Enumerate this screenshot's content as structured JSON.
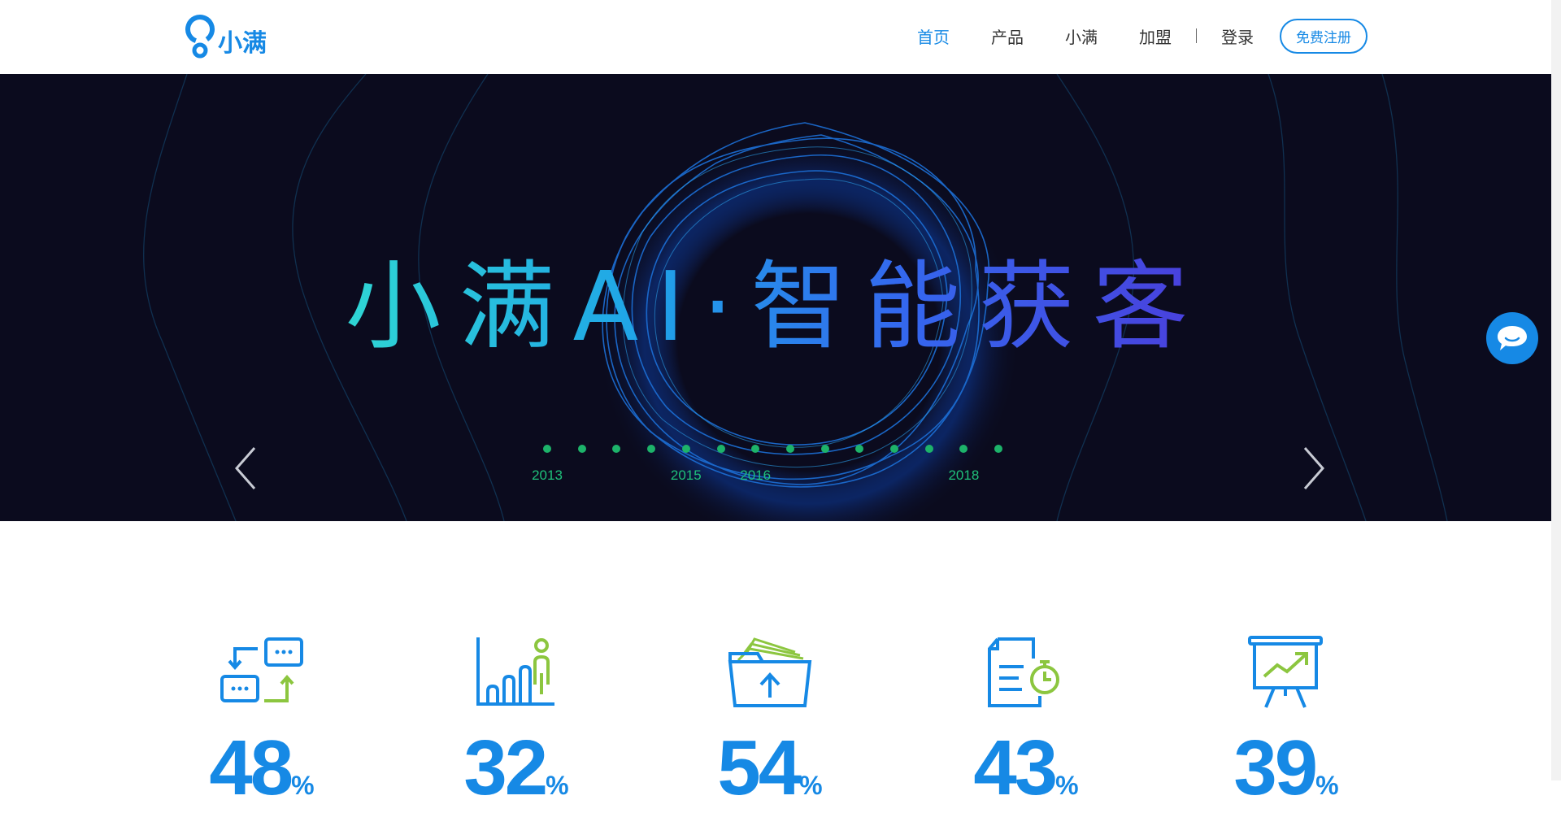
{
  "brand": {
    "name": "小满",
    "color": "#1689e5"
  },
  "nav": {
    "items": [
      {
        "label": "首页",
        "active": true
      },
      {
        "label": "产品",
        "active": false
      },
      {
        "label": "小满",
        "active": false
      },
      {
        "label": "加盟",
        "active": false
      }
    ],
    "login": "登录",
    "register": "免费注册"
  },
  "banner": {
    "title": "小满AI·智能获客",
    "prev_icon": "chevron-left-icon",
    "next_icon": "chevron-right-icon",
    "timeline": {
      "dot_count": 14,
      "dot_color": "#1db36a",
      "years": [
        {
          "label": "2013",
          "dot_index": 0
        },
        {
          "label": "2015",
          "dot_index": 4
        },
        {
          "label": "2016",
          "dot_index": 6
        },
        {
          "label": "2018",
          "dot_index": 12
        }
      ]
    }
  },
  "chat": {
    "icon": "chat-bubble-icon"
  },
  "stats": [
    {
      "icon": "conversation-icon",
      "value": "48",
      "unit": "%"
    },
    {
      "icon": "growth-person-icon",
      "value": "32",
      "unit": "%"
    },
    {
      "icon": "folder-upload-icon",
      "value": "54",
      "unit": "%"
    },
    {
      "icon": "document-timer-icon",
      "value": "43",
      "unit": "%"
    },
    {
      "icon": "presentation-chart-icon",
      "value": "39",
      "unit": "%"
    }
  ]
}
